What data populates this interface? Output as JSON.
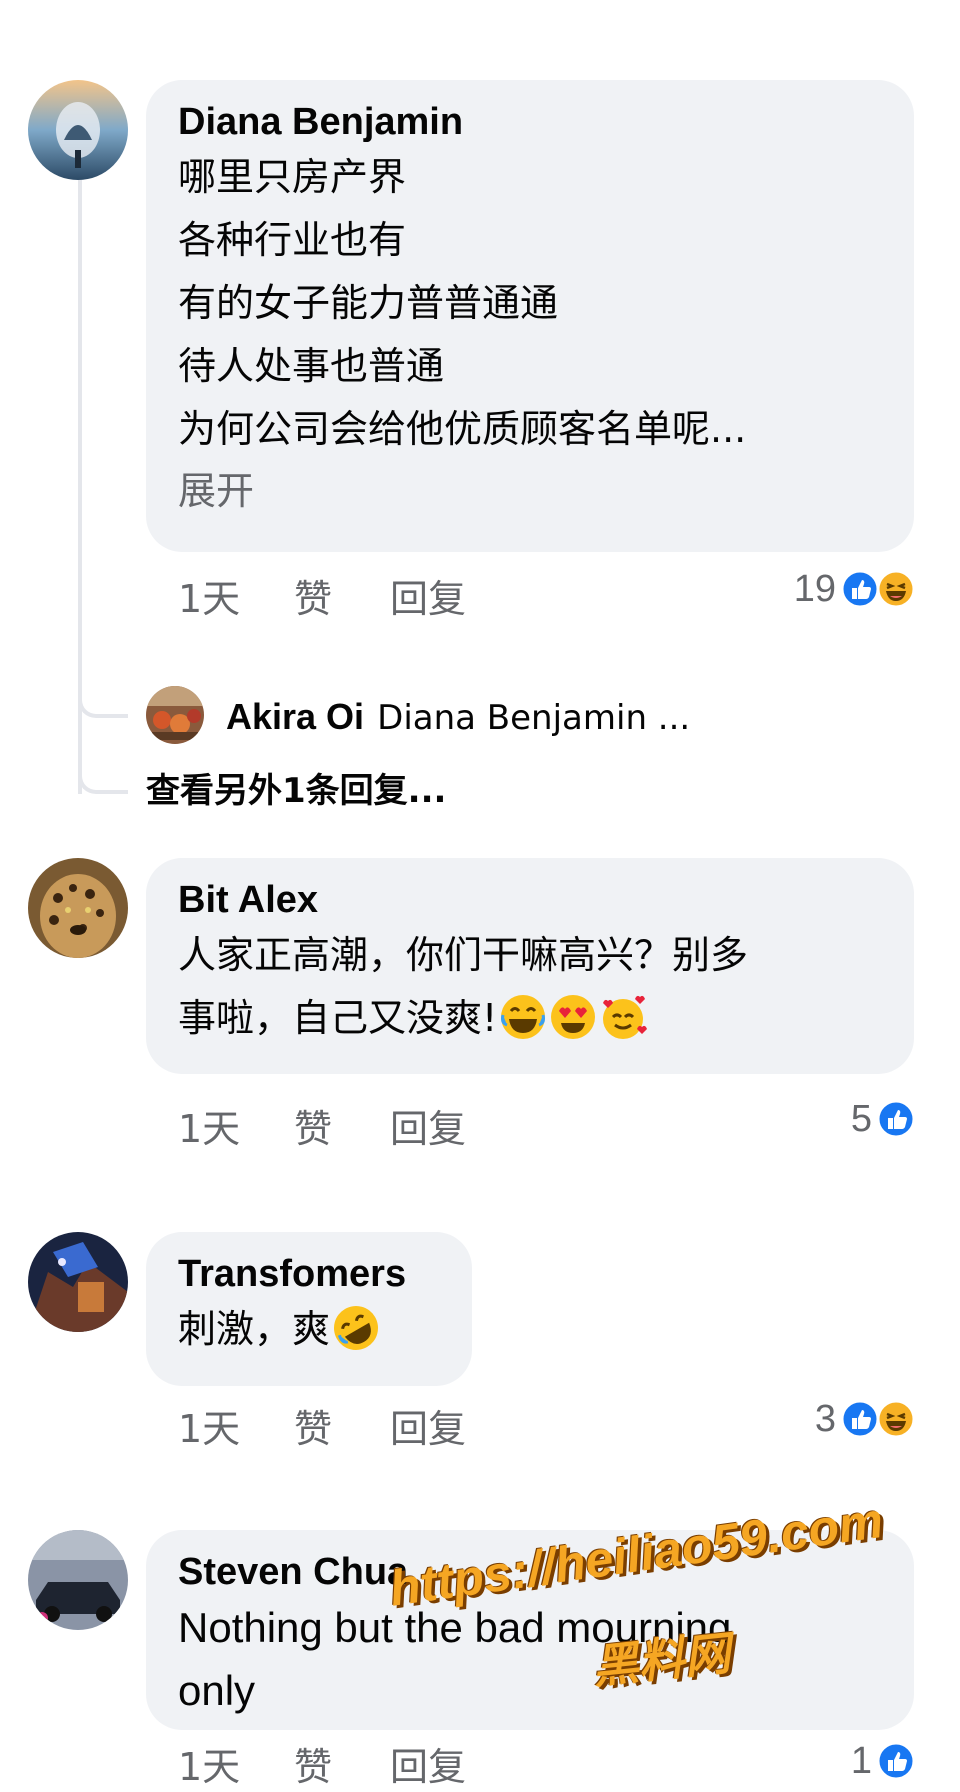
{
  "top_fragment": "…… ……",
  "comments": [
    {
      "author": "Diana Benjamin",
      "lines": [
        "哪里只房产界",
        "各种行业也有",
        "有的女子能力普普通通",
        "待人处事也普通",
        "为何公司会给他优质顾客名单呢..."
      ],
      "expand_label": "展开",
      "time": "1天",
      "like_label": "赞",
      "reply_label": "回复",
      "reaction_count": "19",
      "reactions": [
        "like-icon",
        "haha-icon"
      ]
    },
    {
      "author": "Bit Alex",
      "lines": [
        "人家正高潮，你们干嘛高兴？别多",
        "事啦，自己又没爽!"
      ],
      "emojis": [
        "laughing-tears-emoji",
        "heart-eyes-emoji",
        "smiling-hearts-emoji"
      ],
      "time": "1天",
      "like_label": "赞",
      "reply_label": "回复",
      "reaction_count": "5",
      "reactions": [
        "like-icon"
      ]
    },
    {
      "author": "Transfomers",
      "lines": [
        "刺激，爽"
      ],
      "emojis": [
        "rolling-laughing-emoji"
      ],
      "time": "1天",
      "like_label": "赞",
      "reply_label": "回复",
      "reaction_count": "3",
      "reactions": [
        "like-icon",
        "haha-icon"
      ]
    },
    {
      "author": "Steven Chua",
      "lines": [
        "Nothing but the bad mourning",
        "only"
      ],
      "time": "1天",
      "like_label": "赞",
      "reply_label": "回复",
      "reaction_count": "1",
      "reactions": [
        "like-icon"
      ]
    }
  ],
  "reply_preview": {
    "author": "Akira Oi",
    "text": "Diana Benjamin ..."
  },
  "see_more_replies": "查看另外1条回复...",
  "watermark": {
    "url": "https://heiliao59.com",
    "text": "黑料网"
  },
  "colors": {
    "bubble": "#f0f2f5",
    "secondary_text": "#65676b",
    "like_blue": "#1877f2",
    "watermark": "#f5a623"
  }
}
